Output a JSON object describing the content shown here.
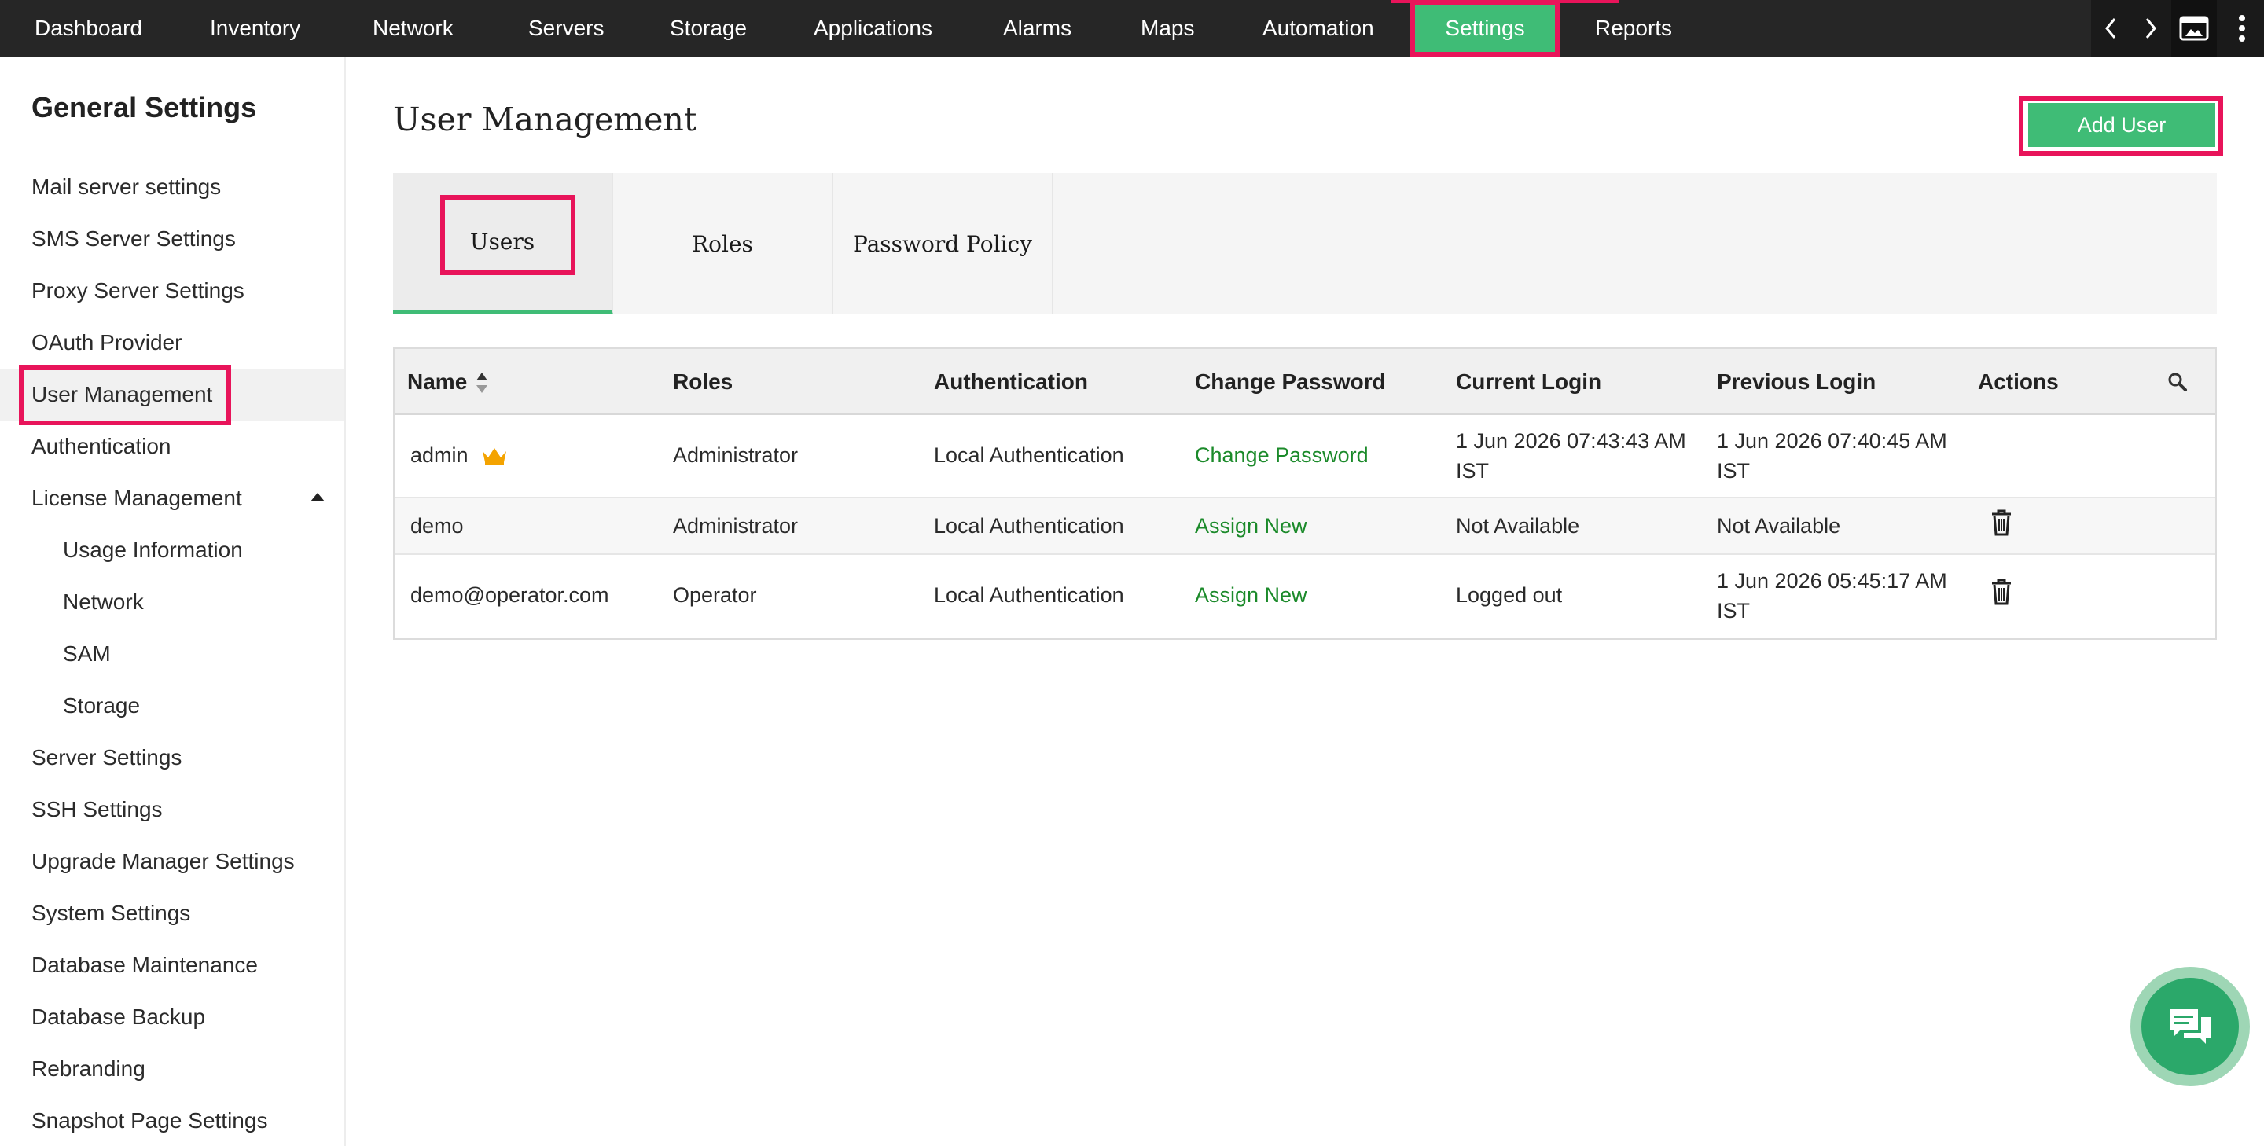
{
  "topnav": {
    "items": [
      "Dashboard",
      "Inventory",
      "Network",
      "Servers",
      "Storage",
      "Applications",
      "Alarms",
      "Maps",
      "Automation",
      "Settings",
      "Reports"
    ],
    "active": "Settings",
    "tools": [
      "chevron-left-icon",
      "chevron-right-icon",
      "window-icon",
      "more-vertical-icon"
    ]
  },
  "sidebar": {
    "title": "General Settings",
    "items": [
      "Mail server settings",
      "SMS Server Settings",
      "Proxy Server Settings",
      "OAuth Provider",
      "User Management",
      "Authentication",
      "License Management",
      "Usage Information",
      "Network",
      "SAM",
      "Storage",
      "Server Settings",
      "SSH Settings",
      "Upgrade Manager Settings",
      "System Settings",
      "Database Maintenance",
      "Database Backup",
      "Rebranding",
      "Snapshot Page Settings"
    ],
    "active": "User Management"
  },
  "main": {
    "title": "User Management",
    "add_user_label": "Add User",
    "tabs": [
      "Users",
      "Roles",
      "Password Policy"
    ],
    "active_tab": "Users"
  },
  "table": {
    "headers": [
      "Name",
      "Roles",
      "Authentication",
      "Change Password",
      "Current Login",
      "Previous Login",
      "Actions"
    ],
    "rows": [
      {
        "name": "admin",
        "role": "Administrator",
        "auth": "Local Authentication",
        "password_action": "Change Password",
        "current_login": "1 Jun 2026 07:43:43 AM IST",
        "previous_login": "1 Jun 2026 07:40:45 AM IST"
      },
      {
        "name": "demo",
        "role": "Administrator",
        "auth": "Local Authentication",
        "password_action": "Assign New",
        "current_login": "Not Available",
        "previous_login": "Not Available"
      },
      {
        "name": "demo@operator.com",
        "role": "Operator",
        "auth": "Local Authentication",
        "password_action": "Assign New",
        "current_login": "Logged out",
        "previous_login": "1 Jun 2026 05:45:17 AM IST"
      }
    ]
  },
  "colors": {
    "accent_green": "#3fbc76",
    "highlight_pink": "#e8145a",
    "link_green": "#1b8a2a",
    "nav_bg": "#262626",
    "crown": "#f4a300"
  }
}
